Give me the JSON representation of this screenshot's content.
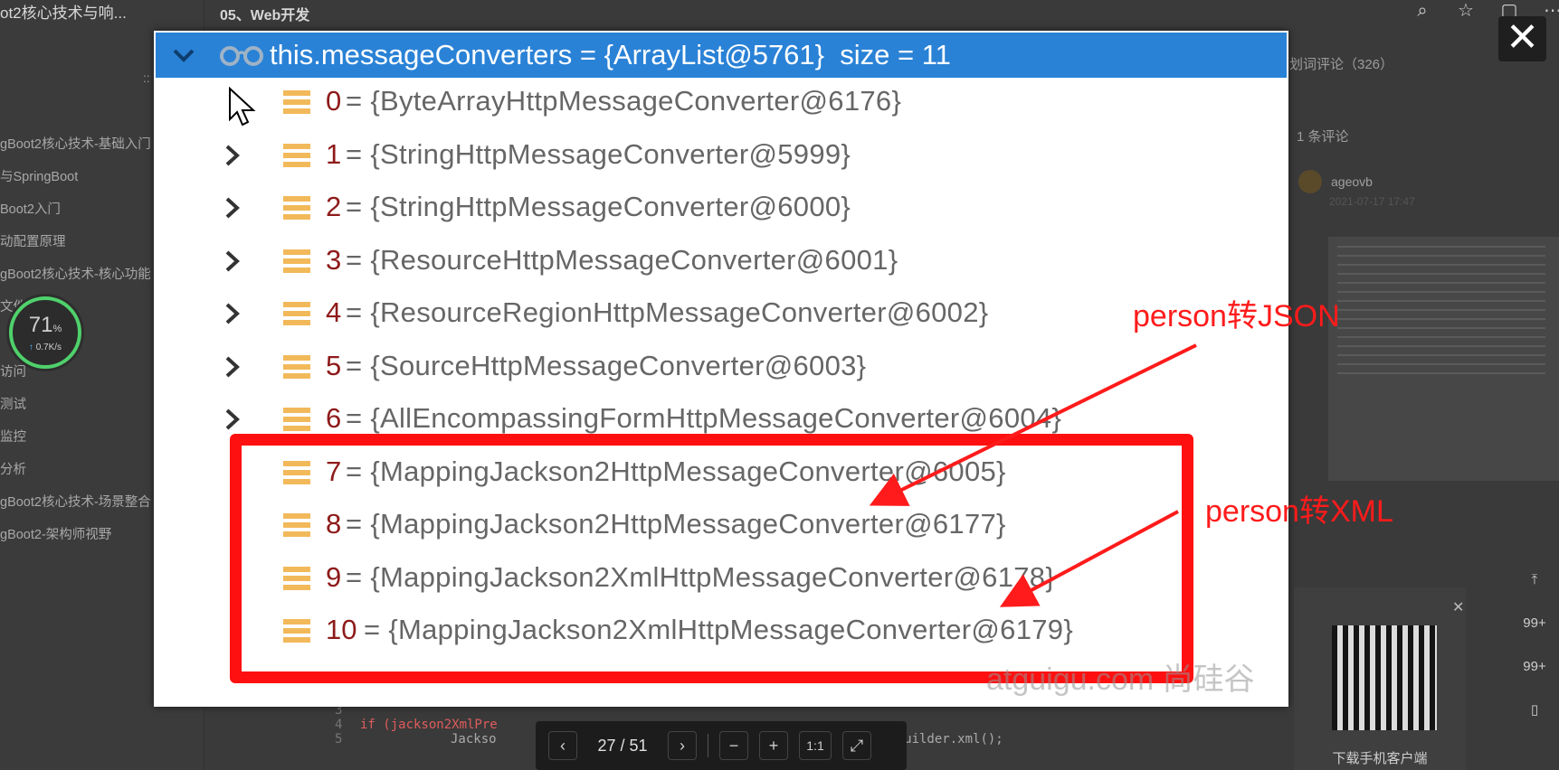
{
  "background": {
    "doc_title": "ot2核心技术与响...",
    "collapse_glyph": "::",
    "toc": [
      "gBoot2核心技术-基础入门",
      "与SpringBoot",
      "Boot2入门",
      "动配置原理",
      "gBoot2核心技术-核心功能",
      "文件",
      "",
      "访问",
      "测试",
      "监控",
      "分析",
      "gBoot2核心技术-场景整合",
      "gBoot2-架构师视野"
    ],
    "speed_percent": "71",
    "speed_unit": "%",
    "speed_rate": "0.7K/s",
    "header_title": "05、Web开发",
    "comments_head": "划词评论（326）",
    "comment_count": "1 条评论",
    "comment_user": "ageovb",
    "comment_time": "2021-07-17 17:47",
    "qr_caption": "下载手机客户端",
    "side_counts": [
      "99+",
      "99+"
    ],
    "code_lines": [
      {
        "num": "3",
        "text": ""
      },
      {
        "num": "4",
        "text": "if (jackson2XmlPre"
      },
      {
        "num": "5",
        "text": "Jackso"
      },
      {
        "num": "",
        "text": "apperBuilder.xml();"
      }
    ]
  },
  "pager": {
    "current": "27 / 51",
    "ratio_label": "1:1"
  },
  "debugger": {
    "header": "this.messageConverters = {ArrayList@5761}  size = 11",
    "items": [
      {
        "index": "0",
        "value": "= {ByteArrayHttpMessageConverter@6176}"
      },
      {
        "index": "1",
        "value": "= {StringHttpMessageConverter@5999}"
      },
      {
        "index": "2",
        "value": "= {StringHttpMessageConverter@6000}"
      },
      {
        "index": "3",
        "value": "= {ResourceHttpMessageConverter@6001}"
      },
      {
        "index": "4",
        "value": "= {ResourceRegionHttpMessageConverter@6002}"
      },
      {
        "index": "5",
        "value": "= {SourceHttpMessageConverter@6003}"
      },
      {
        "index": "6",
        "value": "= {AllEncompassingFormHttpMessageConverter@6004}"
      },
      {
        "index": "7",
        "value": "= {MappingJackson2HttpMessageConverter@6005}"
      },
      {
        "index": "8",
        "value": "= {MappingJackson2HttpMessageConverter@6177}"
      },
      {
        "index": "9",
        "value": "= {MappingJackson2XmlHttpMessageConverter@6178}"
      },
      {
        "index": "10",
        "value": "= {MappingJackson2XmlHttpMessageConverter@6179}"
      }
    ],
    "watermark": "atguigu.com 尚硅谷"
  },
  "annotations": {
    "json_label": "person转JSON",
    "xml_label": "person转XML",
    "color": "#ff1b1b"
  }
}
